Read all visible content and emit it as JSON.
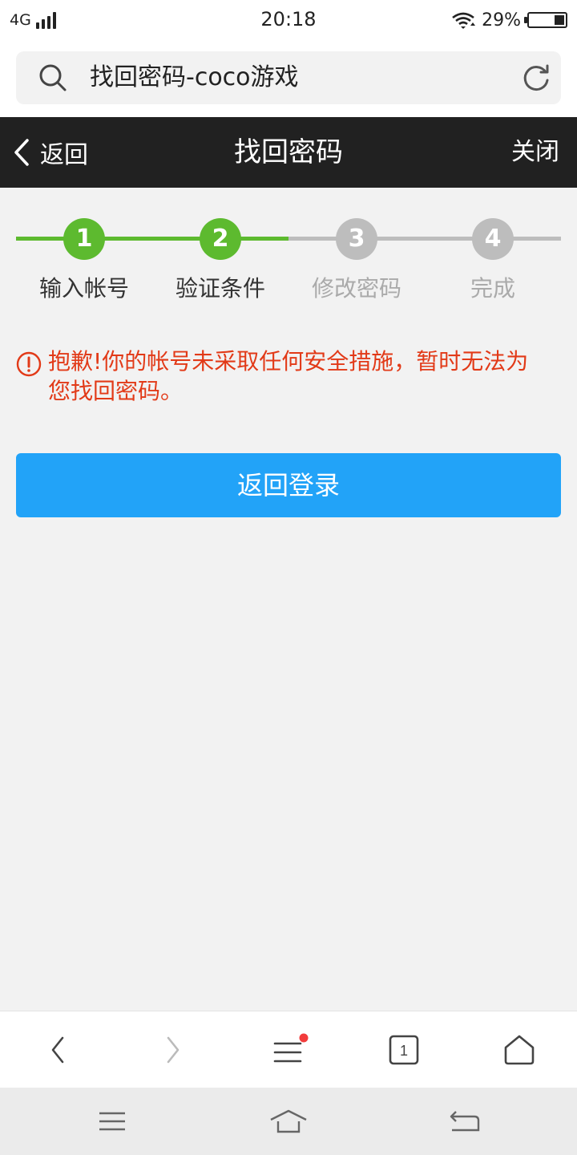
{
  "status_bar": {
    "network": "4G",
    "time": "20:18",
    "battery": "29%",
    "battery_level": 0.29
  },
  "address_bar": {
    "text": "找回密码-coco游戏"
  },
  "header": {
    "back_label": "返回",
    "title": "找回密码",
    "close_label": "关闭"
  },
  "steps": {
    "items": [
      {
        "number": "1",
        "label": "输入帐号",
        "state": "done"
      },
      {
        "number": "2",
        "label": "验证条件",
        "state": "current"
      },
      {
        "number": "3",
        "label": "修改密码",
        "state": "todo"
      },
      {
        "number": "4",
        "label": "完成",
        "state": "todo"
      }
    ],
    "active_color": "#5dba2f",
    "inactive_color": "#bdbdbd"
  },
  "error": {
    "message": "抱歉!你的帐号未采取任何安全措施，暂时无法为您找回密码。",
    "color": "#e23a18"
  },
  "actions": {
    "primary_label": "返回登录",
    "primary_color": "#22a3f8"
  },
  "browser_toolbar": {
    "items": [
      "back-arrow-icon",
      "forward-arrow-icon",
      "menu-icon",
      "tabs-icon",
      "home-icon"
    ],
    "tab_count": "1",
    "menu_badge_color": "#f23c3c"
  },
  "system_nav": {
    "items": [
      "recent-apps-icon",
      "home-icon",
      "back-icon"
    ]
  }
}
